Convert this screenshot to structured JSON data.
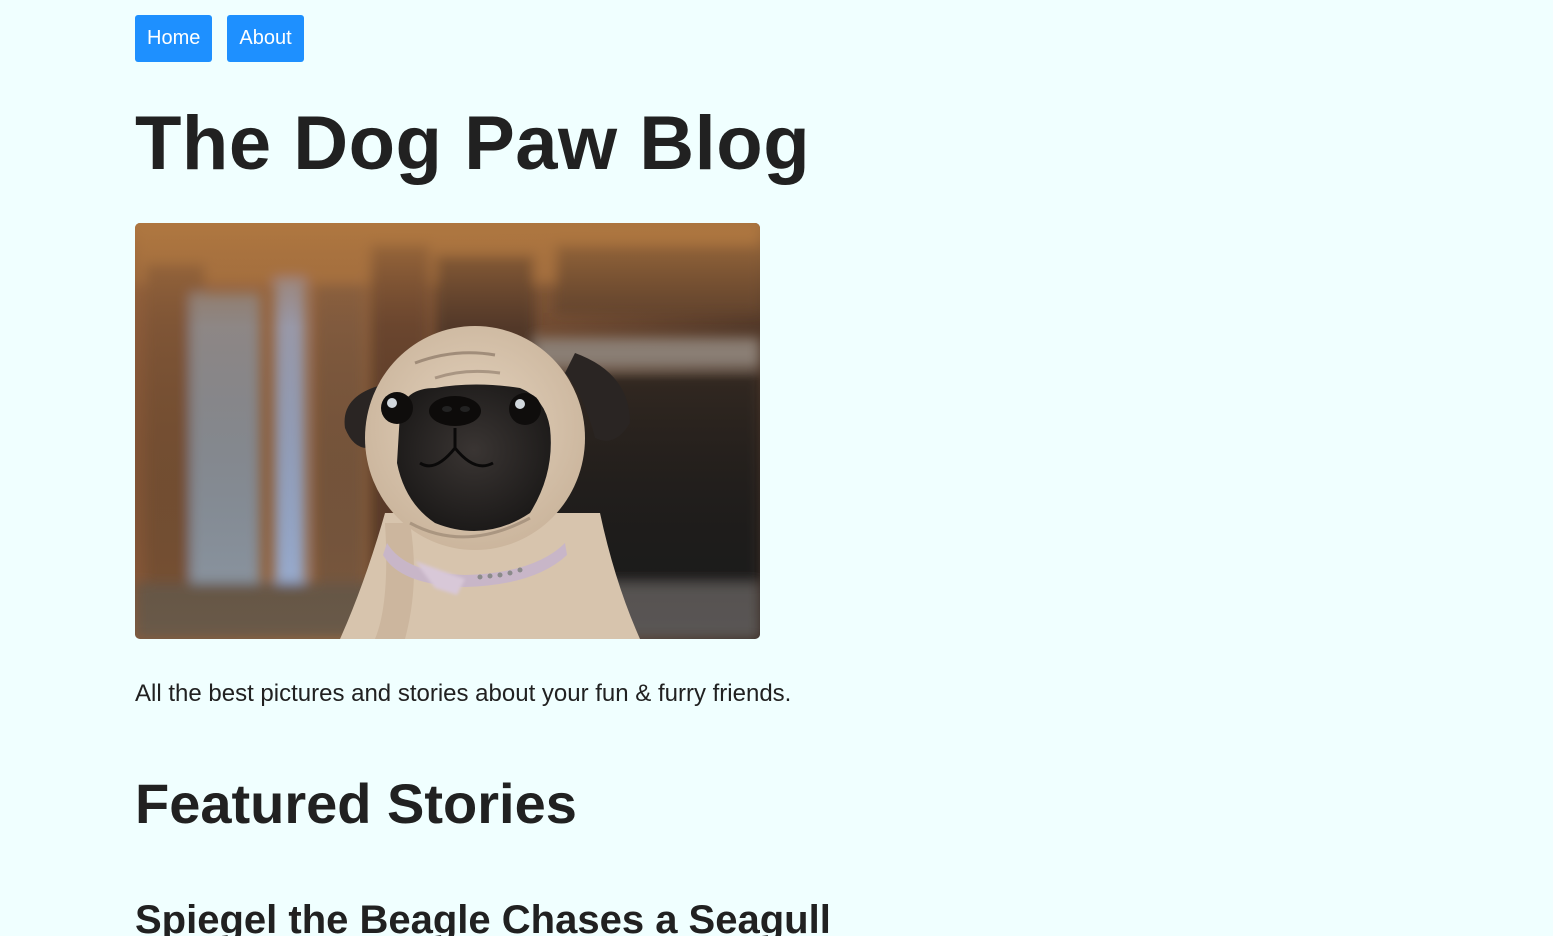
{
  "nav": {
    "home_label": "Home",
    "about_label": "About"
  },
  "header": {
    "title": "The Dog Paw Blog"
  },
  "hero": {
    "subject": "pug-photo"
  },
  "intro": {
    "tagline": "All the best pictures and stories about your fun & furry friends."
  },
  "featured": {
    "heading": "Featured Stories",
    "stories": [
      {
        "title": "Spiegel the Beagle Chases a Seagull"
      }
    ]
  },
  "colors": {
    "background": "#f0ffff",
    "button": "#1e90ff",
    "button_text": "#ffffff",
    "text": "#212121"
  }
}
